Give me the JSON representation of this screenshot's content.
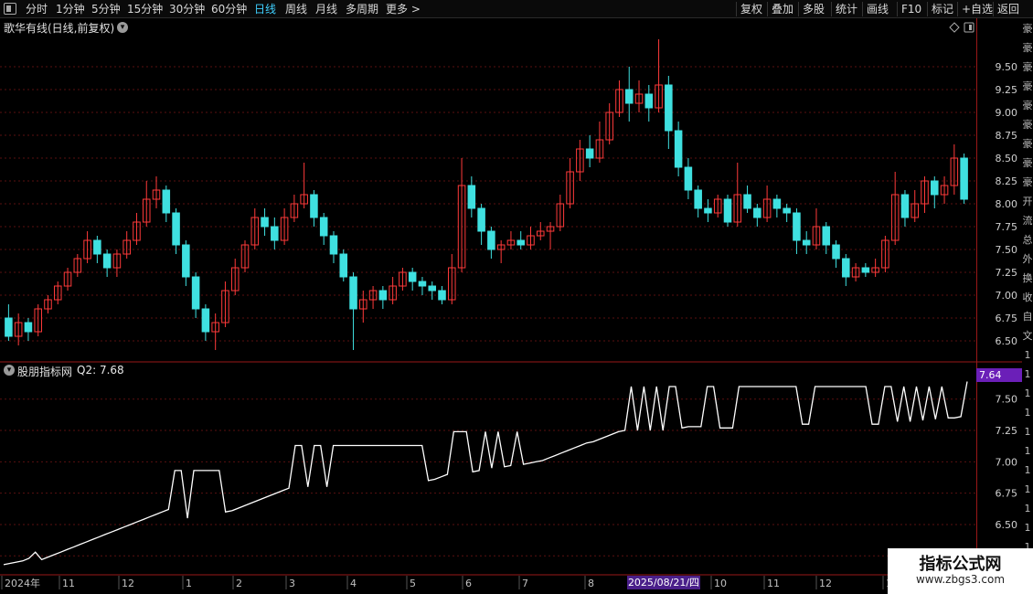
{
  "toolbar": {
    "periods": [
      {
        "label": "分时",
        "active": false
      },
      {
        "label": "1分钟",
        "active": false
      },
      {
        "label": "5分钟",
        "active": false
      },
      {
        "label": "15分钟",
        "active": false
      },
      {
        "label": "30分钟",
        "active": false
      },
      {
        "label": "60分钟",
        "active": false
      },
      {
        "label": "日线",
        "active": true
      },
      {
        "label": "周线",
        "active": false
      },
      {
        "label": "月线",
        "active": false
      },
      {
        "label": "多周期",
        "active": false
      },
      {
        "label": "更多 >",
        "active": false
      }
    ],
    "actions": [
      "复权",
      "叠加",
      "多股",
      "统计",
      "画线",
      "F10",
      "标记",
      "+自选",
      "返回"
    ]
  },
  "main_panel": {
    "title": "歌华有线(日线,前复权)"
  },
  "indicator_panel": {
    "title": "股朋指标网",
    "value_label": "Q2: 7.68",
    "current_value": "7.64"
  },
  "date_axis": {
    "labels": [
      "2024年",
      "11",
      "12",
      "1",
      "2",
      "3",
      "4",
      "5",
      "6",
      "7",
      "8",
      "9",
      "10",
      "11",
      "12",
      "1"
    ],
    "active_date": "2025/08/21/四"
  },
  "right_strip_glyphs": [
    "豪",
    "豪",
    "豪",
    "豪",
    "豪",
    "豪",
    "豪",
    "豪",
    "豪",
    "开",
    "流",
    "总",
    "外",
    "换",
    "收",
    "自",
    "文",
    "1",
    "1",
    "1",
    "1",
    "1",
    "1",
    "1",
    "1",
    "1",
    "1",
    "1",
    "1"
  ],
  "watermark": {
    "title": "指标公式网",
    "url": "www.zbgs3.com"
  },
  "colors": {
    "up": "#ff3a3a",
    "down": "#3fe0e0",
    "indicator_line": "#ffffff",
    "grid": "#5a1010",
    "border": "#9a1818",
    "active_period": "#3fd0ff"
  },
  "chart_data": [
    {
      "type": "candlestick",
      "title": "歌华有线(日线,前复权)",
      "ylim": [
        6.3,
        9.95
      ],
      "yticks": [
        6.5,
        6.75,
        7.0,
        7.25,
        7.5,
        7.75,
        8.0,
        8.25,
        8.5,
        8.75,
        9.0,
        9.25,
        9.5
      ],
      "ohlc": [
        [
          6.75,
          6.55,
          6.9,
          6.5
        ],
        [
          6.55,
          6.7,
          6.8,
          6.45
        ],
        [
          6.7,
          6.6,
          6.75,
          6.5
        ],
        [
          6.6,
          6.85,
          6.9,
          6.55
        ],
        [
          6.85,
          6.95,
          7.0,
          6.8
        ],
        [
          6.95,
          7.1,
          7.15,
          6.9
        ],
        [
          7.1,
          7.25,
          7.3,
          7.05
        ],
        [
          7.25,
          7.4,
          7.45,
          7.2
        ],
        [
          7.4,
          7.6,
          7.7,
          7.35
        ],
        [
          7.6,
          7.45,
          7.65,
          7.35
        ],
        [
          7.45,
          7.3,
          7.5,
          7.2
        ],
        [
          7.3,
          7.45,
          7.5,
          7.2
        ],
        [
          7.45,
          7.6,
          7.7,
          7.4
        ],
        [
          7.6,
          7.8,
          7.9,
          7.55
        ],
        [
          7.8,
          8.05,
          8.25,
          7.75
        ],
        [
          8.05,
          8.15,
          8.3,
          7.95
        ],
        [
          8.15,
          7.9,
          8.2,
          7.8
        ],
        [
          7.9,
          7.55,
          7.95,
          7.45
        ],
        [
          7.55,
          7.2,
          7.6,
          7.1
        ],
        [
          7.2,
          6.85,
          7.25,
          6.75
        ],
        [
          6.85,
          6.6,
          6.9,
          6.5
        ],
        [
          6.6,
          6.7,
          6.8,
          6.4
        ],
        [
          6.7,
          7.05,
          7.15,
          6.65
        ],
        [
          7.05,
          7.3,
          7.4,
          7.0
        ],
        [
          7.3,
          7.55,
          7.6,
          7.25
        ],
        [
          7.55,
          7.85,
          7.95,
          7.5
        ],
        [
          7.85,
          7.75,
          7.95,
          7.65
        ],
        [
          7.75,
          7.6,
          7.85,
          7.5
        ],
        [
          7.6,
          7.85,
          7.95,
          7.55
        ],
        [
          7.85,
          8.0,
          8.1,
          7.8
        ],
        [
          8.0,
          8.1,
          8.45,
          7.95
        ],
        [
          8.1,
          7.85,
          8.15,
          7.75
        ],
        [
          7.85,
          7.65,
          7.9,
          7.55
        ],
        [
          7.65,
          7.45,
          7.7,
          7.35
        ],
        [
          7.45,
          7.2,
          7.5,
          7.15
        ],
        [
          7.2,
          6.85,
          7.25,
          6.4
        ],
        [
          6.85,
          6.95,
          7.05,
          6.7
        ],
        [
          6.95,
          7.05,
          7.1,
          6.85
        ],
        [
          7.05,
          6.95,
          7.1,
          6.85
        ],
        [
          6.95,
          7.1,
          7.2,
          6.9
        ],
        [
          7.1,
          7.25,
          7.3,
          7.05
        ],
        [
          7.25,
          7.15,
          7.3,
          7.05
        ],
        [
          7.15,
          7.1,
          7.2,
          7.0
        ],
        [
          7.1,
          7.05,
          7.15,
          6.95
        ],
        [
          7.05,
          6.95,
          7.1,
          6.9
        ],
        [
          6.95,
          7.3,
          7.45,
          6.9
        ],
        [
          7.3,
          8.2,
          8.5,
          7.25
        ],
        [
          8.2,
          7.95,
          8.3,
          7.85
        ],
        [
          7.95,
          7.7,
          8.0,
          7.55
        ],
        [
          7.7,
          7.5,
          7.75,
          7.4
        ],
        [
          7.5,
          7.55,
          7.6,
          7.35
        ],
        [
          7.55,
          7.6,
          7.7,
          7.5
        ],
        [
          7.6,
          7.55,
          7.7,
          7.5
        ],
        [
          7.55,
          7.65,
          7.75,
          7.5
        ],
        [
          7.65,
          7.7,
          7.8,
          7.6
        ],
        [
          7.7,
          7.75,
          7.8,
          7.5
        ],
        [
          7.75,
          8.0,
          8.1,
          7.7
        ],
        [
          8.0,
          8.35,
          8.5,
          7.95
        ],
        [
          8.35,
          8.6,
          8.7,
          8.25
        ],
        [
          8.6,
          8.5,
          8.75,
          8.4
        ],
        [
          8.5,
          8.7,
          8.9,
          8.45
        ],
        [
          8.7,
          9.0,
          9.1,
          8.65
        ],
        [
          9.0,
          9.25,
          9.35,
          8.95
        ],
        [
          9.25,
          9.1,
          9.5,
          8.9
        ],
        [
          9.1,
          9.2,
          9.35,
          9.0
        ],
        [
          9.2,
          9.05,
          9.3,
          8.9
        ],
        [
          9.05,
          9.3,
          9.8,
          9.0
        ],
        [
          9.3,
          8.8,
          9.4,
          8.6
        ],
        [
          8.8,
          8.4,
          8.9,
          8.3
        ],
        [
          8.4,
          8.15,
          8.5,
          8.05
        ],
        [
          8.15,
          7.95,
          8.2,
          7.85
        ],
        [
          7.95,
          7.9,
          8.05,
          7.8
        ],
        [
          7.9,
          8.05,
          8.1,
          7.85
        ],
        [
          8.05,
          7.8,
          8.1,
          7.75
        ],
        [
          7.8,
          8.1,
          8.45,
          7.75
        ],
        [
          8.1,
          7.95,
          8.2,
          7.9
        ],
        [
          7.95,
          7.85,
          8.0,
          7.75
        ],
        [
          7.85,
          8.05,
          8.2,
          7.8
        ],
        [
          8.05,
          7.95,
          8.1,
          7.85
        ],
        [
          7.95,
          7.9,
          8.0,
          7.8
        ],
        [
          7.9,
          7.6,
          7.95,
          7.45
        ],
        [
          7.6,
          7.55,
          7.7,
          7.45
        ],
        [
          7.55,
          7.75,
          7.95,
          7.5
        ],
        [
          7.75,
          7.55,
          7.8,
          7.45
        ],
        [
          7.55,
          7.4,
          7.6,
          7.3
        ],
        [
          7.4,
          7.2,
          7.45,
          7.1
        ],
        [
          7.2,
          7.3,
          7.35,
          7.15
        ],
        [
          7.3,
          7.25,
          7.35,
          7.2
        ],
        [
          7.25,
          7.3,
          7.4,
          7.2
        ],
        [
          7.3,
          7.6,
          7.65,
          7.25
        ],
        [
          7.6,
          8.1,
          8.35,
          7.55
        ],
        [
          8.1,
          7.85,
          8.15,
          7.75
        ],
        [
          7.85,
          8.0,
          8.15,
          7.8
        ],
        [
          8.0,
          8.25,
          8.3,
          7.9
        ],
        [
          8.25,
          8.1,
          8.3,
          7.95
        ],
        [
          8.1,
          8.2,
          8.3,
          8.0
        ],
        [
          8.2,
          8.5,
          8.65,
          8.1
        ],
        [
          8.5,
          8.05,
          8.55,
          8.0
        ]
      ]
    },
    {
      "type": "line",
      "series": [
        {
          "name": "Q2"
        }
      ],
      "ylim": [
        6.15,
        7.68
      ],
      "yticks": [
        6.25,
        6.5,
        6.75,
        7.0,
        7.25,
        7.5
      ],
      "values": [
        6.18,
        6.19,
        6.2,
        6.21,
        6.23,
        6.28,
        6.22,
        6.24,
        6.26,
        6.28,
        6.3,
        6.32,
        6.34,
        6.36,
        6.38,
        6.4,
        6.42,
        6.44,
        6.46,
        6.48,
        6.5,
        6.52,
        6.54,
        6.56,
        6.58,
        6.6,
        6.62,
        6.93,
        6.93,
        6.55,
        6.93,
        6.93,
        6.93,
        6.93,
        6.93,
        6.6,
        6.61,
        6.63,
        6.65,
        6.67,
        6.69,
        6.71,
        6.73,
        6.75,
        6.77,
        6.79,
        7.13,
        7.13,
        6.8,
        7.13,
        7.13,
        6.8,
        7.13,
        7.13,
        7.13,
        7.13,
        7.13,
        7.13,
        7.13,
        7.13,
        7.13,
        7.13,
        7.13,
        7.13,
        7.13,
        7.13,
        7.13,
        6.85,
        6.86,
        6.88,
        6.9,
        7.24,
        7.24,
        7.24,
        6.92,
        6.93,
        7.24,
        6.95,
        7.24,
        6.96,
        6.97,
        7.24,
        6.98,
        6.99,
        7.0,
        7.01,
        7.03,
        7.05,
        7.07,
        7.09,
        7.11,
        7.13,
        7.15,
        7.16,
        7.18,
        7.2,
        7.22,
        7.24,
        7.25,
        7.6,
        7.25,
        7.6,
        7.25,
        7.6,
        7.25,
        7.6,
        7.6,
        7.27,
        7.28,
        7.28,
        7.28,
        7.6,
        7.6,
        7.27,
        7.27,
        7.27,
        7.6,
        7.6,
        7.6,
        7.6,
        7.6,
        7.6,
        7.6,
        7.6,
        7.6,
        7.6,
        7.3,
        7.3,
        7.6,
        7.6,
        7.6,
        7.6,
        7.6,
        7.6,
        7.6,
        7.6,
        7.6,
        7.3,
        7.3,
        7.6,
        7.6,
        7.32,
        7.6,
        7.32,
        7.6,
        7.33,
        7.6,
        7.34,
        7.6,
        7.35,
        7.35,
        7.36,
        7.64
      ]
    }
  ]
}
